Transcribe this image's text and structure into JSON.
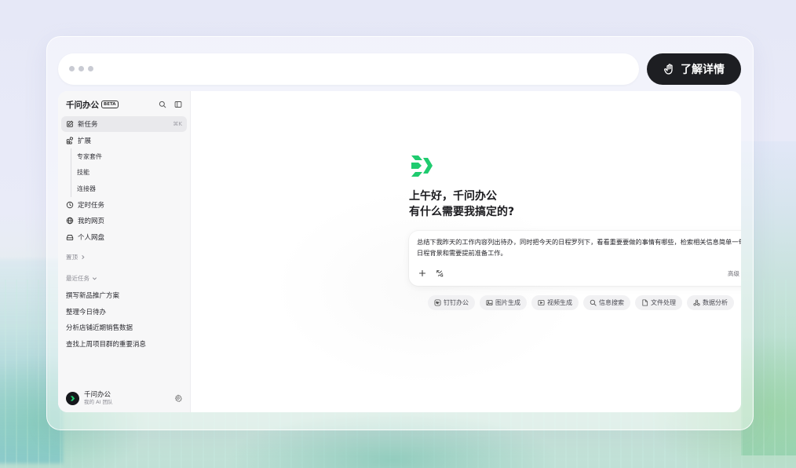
{
  "header": {
    "learn_more_label": "了解详情"
  },
  "sidebar": {
    "title": "千问办公",
    "beta_badge": "BETA",
    "nav": [
      {
        "label": "新任务",
        "shortcut": "⌘K",
        "icon": "new-task-icon"
      },
      {
        "label": "扩展",
        "icon": "extension-icon"
      }
    ],
    "extensions": [
      "专家套件",
      "技能",
      "连接器"
    ],
    "nav2": [
      {
        "label": "定时任务",
        "icon": "clock-icon"
      },
      {
        "label": "我的网页",
        "icon": "globe-icon"
      },
      {
        "label": "个人网盘",
        "icon": "drive-icon"
      }
    ],
    "pinned_label": "置顶",
    "recent_label": "最近任务",
    "recent_tasks": [
      "撰写新品推广方案",
      "整理今日待办",
      "分析店铺近期销售数据",
      "查找上周项目群的重要消息"
    ],
    "user": {
      "name": "千问办公",
      "subtitle": "我的 AI 团队"
    }
  },
  "main": {
    "greeting_line1": "上午好，千问办公",
    "greeting_line2": "有什么需要我搞定的?",
    "composer_text": "总结下我昨天的工作内容列出待办，同时把今天的日程罗列下，看看重要要做的事情有哪些，检索相关信息简单一句话列出日程背景和需要提前准备工作。",
    "mode_label": "高级",
    "chips": [
      {
        "label": "钉钉办公",
        "icon": "dingtalk-icon"
      },
      {
        "label": "图片生成",
        "icon": "image-icon"
      },
      {
        "label": "视频生成",
        "icon": "video-icon"
      },
      {
        "label": "信息搜索",
        "icon": "search-icon"
      },
      {
        "label": "文件处理",
        "icon": "file-icon"
      },
      {
        "label": "数据分析",
        "icon": "data-icon"
      }
    ]
  },
  "colors": {
    "brand_green": "#1fcb6f",
    "dark": "#1d1e22"
  }
}
